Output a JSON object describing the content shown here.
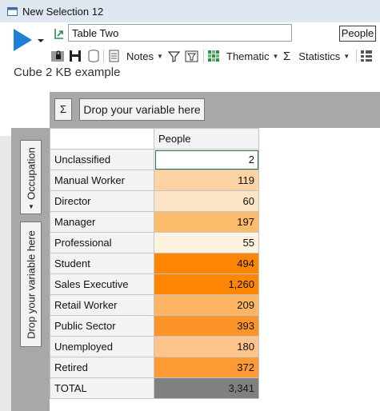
{
  "window": {
    "title": "New Selection 12"
  },
  "toolbar": {
    "table_name": "Table Two",
    "people_label": "People",
    "notes_label": "Notes",
    "thematic_label": "Thematic",
    "statistics_label": "Statistics"
  },
  "subtitle": "Cube 2 KB example",
  "pivot": {
    "sigma_label": "Σ",
    "column_drop_label": "Drop your variable here",
    "row_variable": "Occupation",
    "row_drop_label": "Drop your variable here",
    "column_header": "People",
    "rows": [
      {
        "label": "Unclassified",
        "value": "2",
        "color": "#ffffff"
      },
      {
        "label": "Manual Worker",
        "value": "119",
        "color": "#fdd3a3"
      },
      {
        "label": "Director",
        "value": "60",
        "color": "#fde4c7"
      },
      {
        "label": "Manager",
        "value": "197",
        "color": "#fdbb6c"
      },
      {
        "label": "Professional",
        "value": "55",
        "color": "#fdf1e0"
      },
      {
        "label": "Student",
        "value": "494",
        "color": "#fd8703"
      },
      {
        "label": "Sales Executive",
        "value": "1,260",
        "color": "#fd8703"
      },
      {
        "label": "Retail Worker",
        "value": "209",
        "color": "#fdb564"
      },
      {
        "label": "Public Sector",
        "value": "393",
        "color": "#fd9428"
      },
      {
        "label": "Unemployed",
        "value": "180",
        "color": "#fdc58b"
      },
      {
        "label": "Retired",
        "value": "372",
        "color": "#fd9a33"
      }
    ],
    "total": {
      "label": "TOTAL",
      "value": "3,341"
    }
  }
}
